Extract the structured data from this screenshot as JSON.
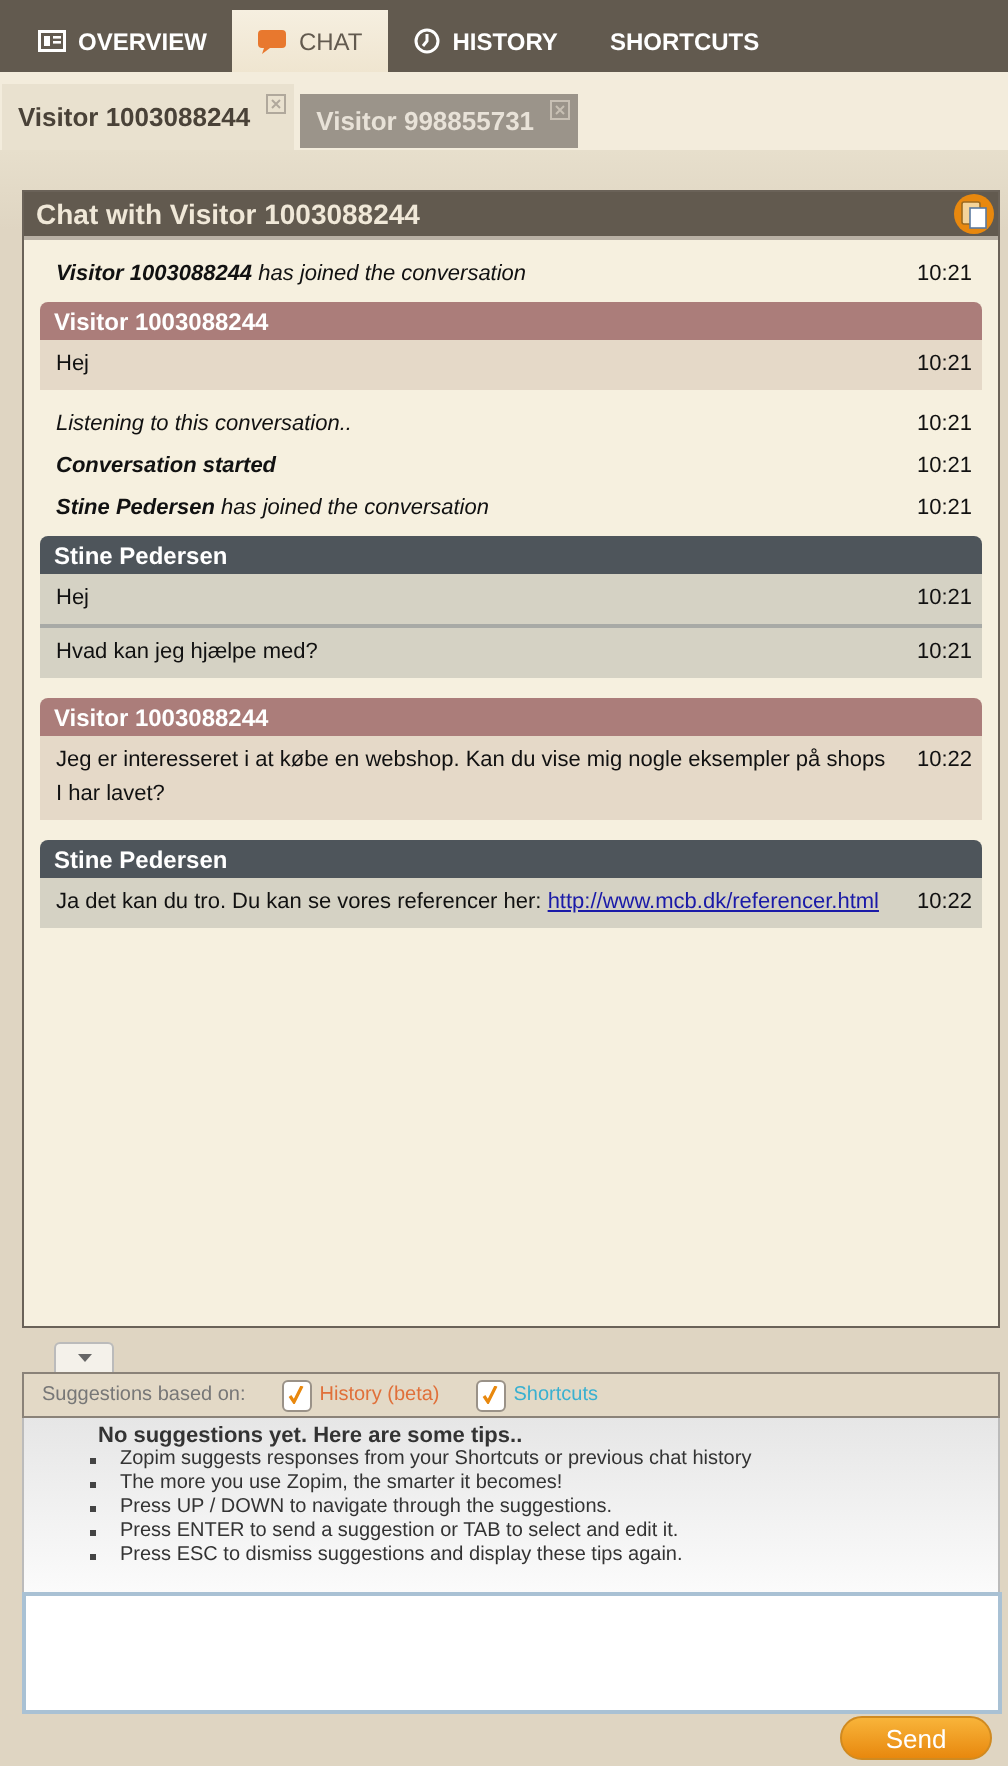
{
  "nav": [
    {
      "label": "OVERVIEW",
      "selected": false
    },
    {
      "label": "CHAT",
      "selected": true
    },
    {
      "label": "HISTORY",
      "selected": false
    },
    {
      "label": "SHORTCUTS",
      "selected": false
    }
  ],
  "visitor_tabs": [
    {
      "label": "Visitor 1003088244",
      "selected": true
    },
    {
      "label": "Visitor 998855731",
      "selected": false
    }
  ],
  "chat": {
    "title": "Chat with Visitor 1003088244",
    "log": [
      {
        "kind": "join",
        "text": "**Visitor 1003088244** has joined the conversation",
        "time": "10:21"
      },
      {
        "kind": "visitor",
        "author": "Visitor 1003088244",
        "messages": [
          {
            "text": "Hej",
            "time": "10:21"
          }
        ]
      },
      {
        "kind": "status",
        "text": "Listening to this conversation..",
        "time": "10:21"
      },
      {
        "kind": "notice",
        "text": "Conversation started",
        "time": "10:21"
      },
      {
        "kind": "join",
        "text": "**Stine Pedersen** has joined the conversation",
        "time": "10:21"
      },
      {
        "kind": "agent",
        "author": "Stine Pedersen",
        "messages": [
          {
            "text": "Hej",
            "time": "10:21"
          },
          {
            "text": "Hvad kan jeg hjælpe med?",
            "time": "10:21"
          }
        ]
      },
      {
        "kind": "visitor",
        "author": "Visitor 1003088244",
        "messages": [
          {
            "text": "Jeg er interesseret i at købe en webshop. Kan du vise mig nogle eksempler på shops I har lavet?",
            "time": "10:22"
          }
        ]
      },
      {
        "kind": "agent",
        "author": "Stine Pedersen",
        "messages": [
          {
            "text": "Ja det kan du tro. Du kan se vores referencer her:",
            "link": "http://www.mcb.dk/referencer.html",
            "time": "10:22"
          }
        ]
      }
    ]
  },
  "suggestions": {
    "label": "Suggestions based on:",
    "sources": [
      {
        "label": "History (beta)",
        "checked": true,
        "color": "#e0703a"
      },
      {
        "label": "Shortcuts",
        "checked": true,
        "color": "#3ab0d0"
      }
    ],
    "tips_title": "No suggestions yet. Here are some tips..",
    "tips": [
      "Zopim suggests responses from your Shortcuts or previous chat history",
      "The more you use Zopim, the smarter it becomes!",
      "Press UP / DOWN to navigate through the suggestions.",
      "Press ENTER to send a suggestion or TAB to select and edit it.",
      "Press ESC to dismiss suggestions and display these tips again."
    ]
  },
  "send_button": "Send"
}
